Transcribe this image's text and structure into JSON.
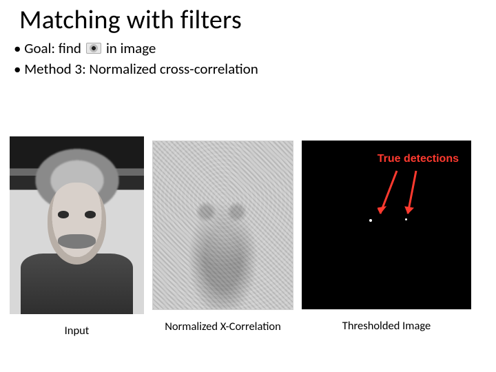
{
  "title": "Matching with filters",
  "bullets": {
    "goal_prefix": "• Goal: find",
    "goal_suffix": "in image",
    "method": "• Method 3: Normalized cross-correlation"
  },
  "panels": {
    "input_caption": "Input",
    "ncc_caption": "Normalized X-Correlation",
    "thresh_caption": "Thresholded Image",
    "true_detections_label": "True detections"
  },
  "icons": {
    "eye": "eye-icon"
  }
}
